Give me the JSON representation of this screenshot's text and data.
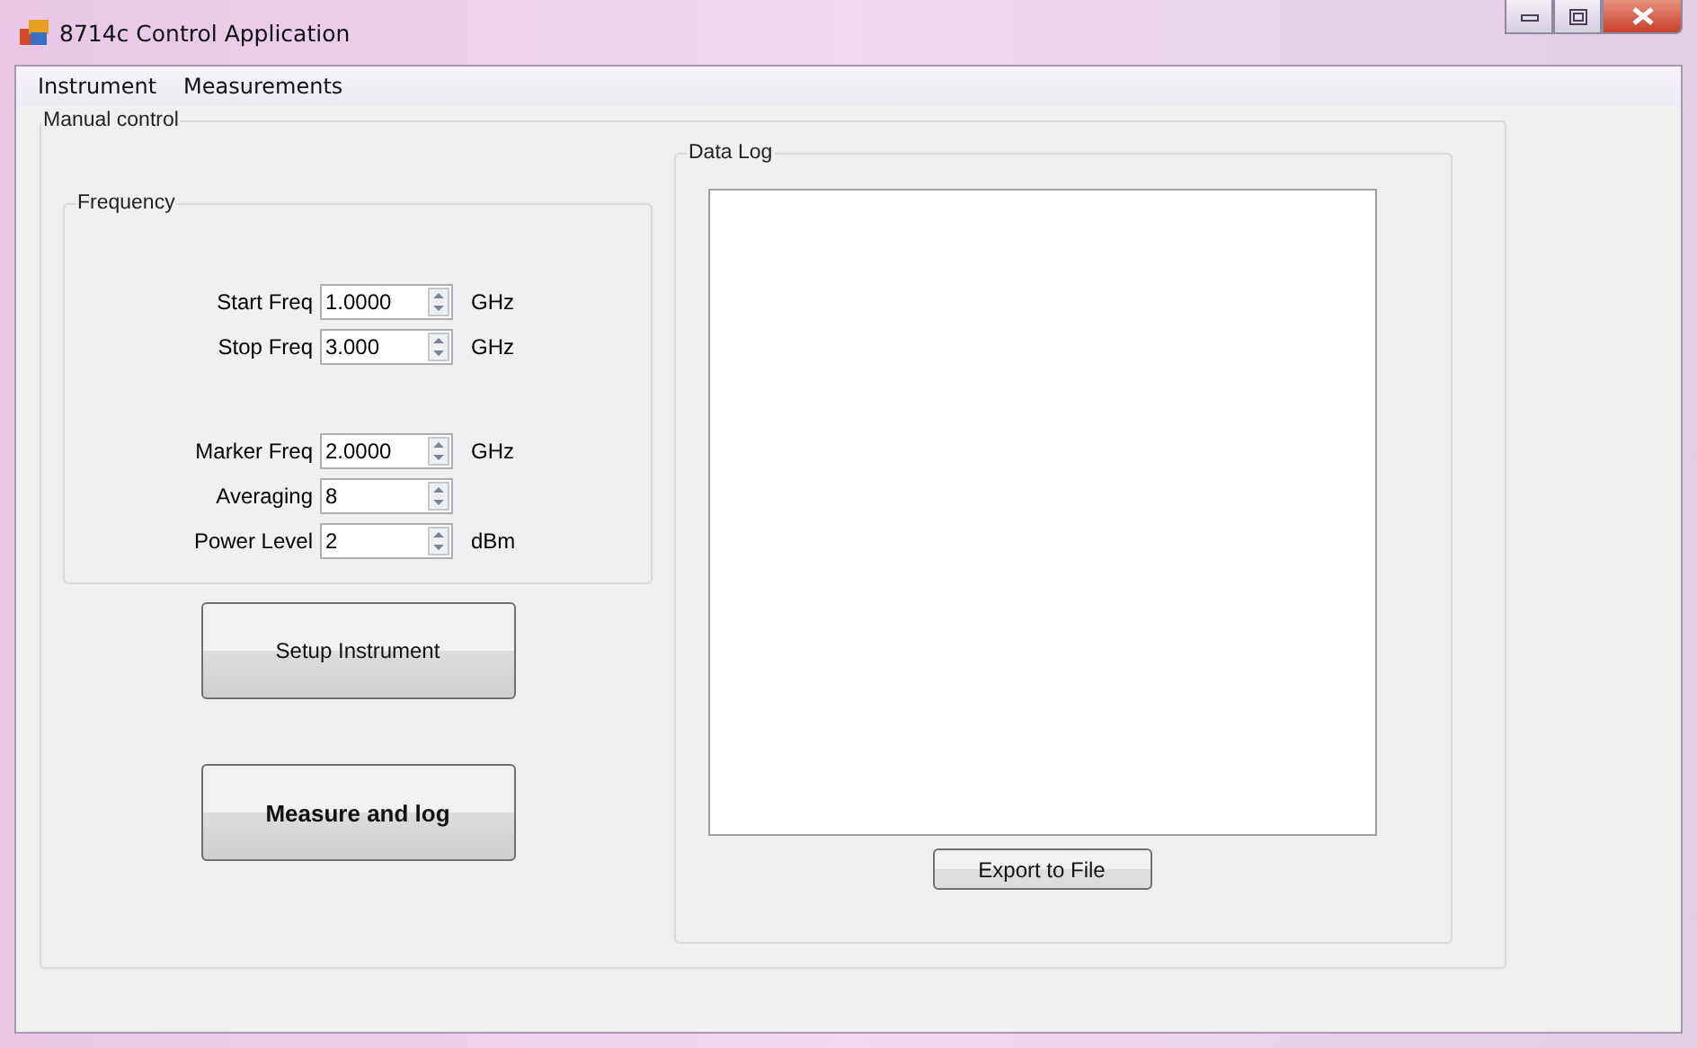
{
  "window": {
    "title": "8714c Control Application"
  },
  "menu": [
    "Instrument",
    "Measurements"
  ],
  "manual_control": {
    "title": "Manual control",
    "frequency": {
      "title": "Frequency",
      "field_groups": [
        [
          {
            "label": "Start Freq",
            "value": "1.0000",
            "unit": "GHz"
          },
          {
            "label": "Stop Freq",
            "value": "3.000",
            "unit": "GHz"
          }
        ],
        [
          {
            "label": "Marker Freq",
            "value": "2.0000",
            "unit": "GHz"
          },
          {
            "label": "Averaging",
            "value": "8"
          },
          {
            "label": "Power Level",
            "value": "2",
            "unit": "dBm"
          }
        ]
      ]
    },
    "buttons": [
      {
        "label": "Setup Instrument",
        "bold": false
      },
      {
        "label": "Measure and log",
        "bold": true
      }
    ],
    "data_log": {
      "title": "Data Log",
      "button": "Export to File"
    }
  }
}
